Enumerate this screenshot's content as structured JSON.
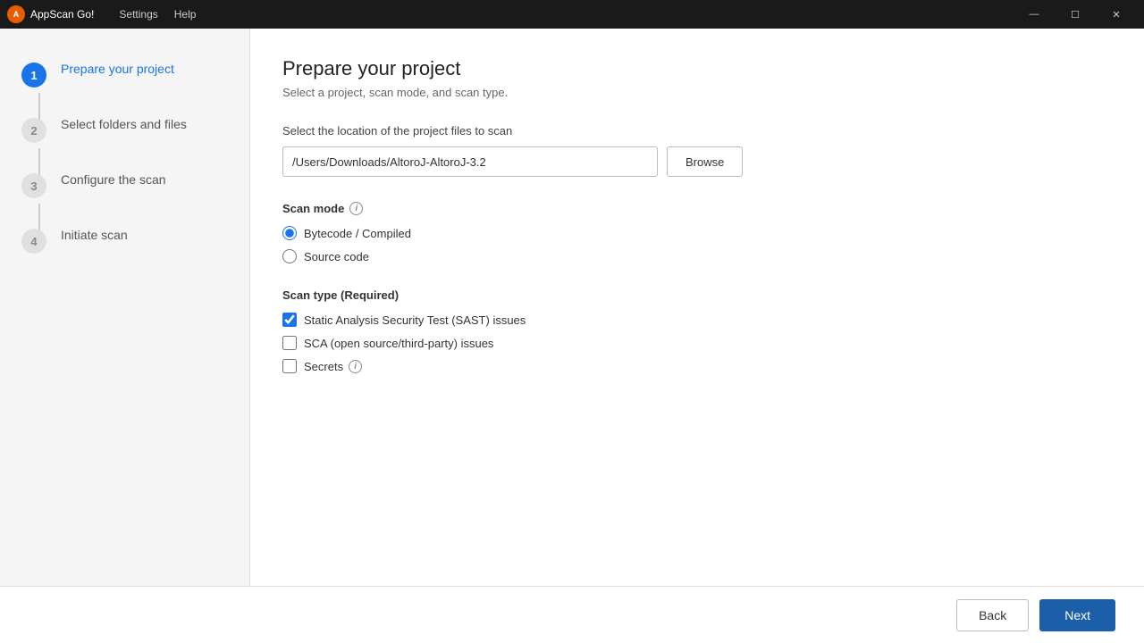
{
  "titlebar": {
    "logo_text": "A",
    "app_name": "AppScan Go!",
    "menu_items": [
      "Settings",
      "Help"
    ],
    "controls": {
      "minimize": "—",
      "maximize": "☐",
      "close": "✕"
    }
  },
  "sidebar": {
    "steps": [
      {
        "number": "1",
        "label": "Prepare your project",
        "state": "active"
      },
      {
        "number": "2",
        "label": "Select folders and files",
        "state": "inactive"
      },
      {
        "number": "3",
        "label": "Configure the scan",
        "state": "inactive"
      },
      {
        "number": "4",
        "label": "Initiate scan",
        "state": "inactive"
      }
    ]
  },
  "content": {
    "title": "Prepare your project",
    "subtitle": "Select a project, scan mode, and scan type.",
    "file_section": {
      "label": "Select the location of the project files to scan",
      "input_value": "/Users/Downloads/AltoroJ-AltoroJ-3.2",
      "browse_label": "Browse"
    },
    "scan_mode": {
      "title": "Scan mode",
      "options": [
        {
          "id": "bytecode",
          "label": "Bytecode / Compiled",
          "checked": true
        },
        {
          "id": "source",
          "label": "Source code",
          "checked": false
        }
      ]
    },
    "scan_type": {
      "title": "Scan type (Required)",
      "options": [
        {
          "id": "sast",
          "label": "Static Analysis Security Test (SAST) issues",
          "checked": true
        },
        {
          "id": "sca",
          "label": "SCA (open source/third-party) issues",
          "checked": false
        },
        {
          "id": "secrets",
          "label": "Secrets",
          "checked": false,
          "has_info": true
        }
      ]
    }
  },
  "footer": {
    "back_label": "Back",
    "next_label": "Next"
  }
}
